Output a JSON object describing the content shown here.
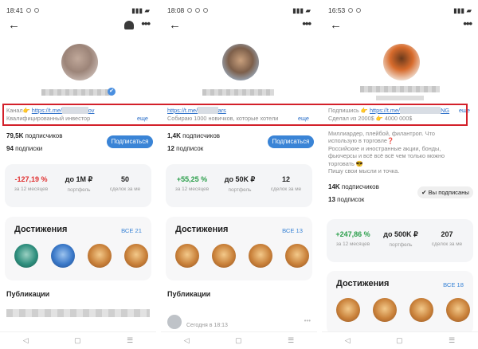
{
  "panels": [
    {
      "status_time": "18:41",
      "bio": {
        "line1_prefix": "Канал👉 ",
        "link": "https://t.me/",
        "link_suffix": "ov",
        "line2": "Квалифицированный инвестор",
        "more": "еще"
      },
      "subscribers": "79,5K",
      "subscribers_label": " подписчиков",
      "following": "94",
      "following_label": " подписки",
      "action_button": "Подписаться",
      "perf": [
        {
          "value": "-127,19 %",
          "label": "за 12 месяцев"
        },
        {
          "value": "до 1М ₽",
          "label": "портфель"
        },
        {
          "value": "50",
          "label": "сделок за ме"
        }
      ],
      "achievements_title": "Достижения",
      "achievements_all": "ВСЕ 21",
      "publications_title": "Публикации"
    },
    {
      "status_time": "18:08",
      "bio": {
        "line1_prefix": "",
        "link": "https://t.me/",
        "link_suffix": "ars",
        "line2": "Собираю 1000 новичков, которые хотели",
        "more": "еще"
      },
      "subscribers": "1,4K",
      "subscribers_label": " подписчиков",
      "following": "12",
      "following_label": " подписок",
      "action_button": "Подписаться",
      "perf": [
        {
          "value": "+55,25 %",
          "label": "за 12 месяцев"
        },
        {
          "value": "до 50K ₽",
          "label": "портфель"
        },
        {
          "value": "12",
          "label": "сделок за ме"
        }
      ],
      "achievements_title": "Достижения",
      "achievements_all": "ВСЕ 13",
      "publications_title": "Публикации",
      "publication_meta": "Сегодня в 18:13"
    },
    {
      "status_time": "16:53",
      "bio": {
        "line1_prefix": "Подпишись 👉 ",
        "link": "https://t.me/",
        "link_suffix": "NG",
        "line2": "Сделал из 2000$ 👉 4000 000$",
        "more": "еще"
      },
      "about": [
        "Миллиардер, плейбой, филантроп. Что",
        "использую в торговле❓",
        "Российские и иностранные акции, бонды,",
        "фьючерсы и всё всё всё чем только можно",
        "торговать 😎",
        "Пишу свои мысли и точка."
      ],
      "subscribers": "14K",
      "subscribers_label": " подписчиков",
      "following": "13",
      "following_label": " подписок",
      "action_button": "✔ Вы подписаны",
      "perf": [
        {
          "value": "+247,86 %",
          "label": "за 12 месяцев"
        },
        {
          "value": "до 500K ₽",
          "label": "портфель"
        },
        {
          "value": "207",
          "label": "сделок за ме"
        }
      ],
      "achievements_title": "Достижения",
      "achievements_all": "ВСЕ 18"
    }
  ],
  "nav": {
    "back": "◁",
    "home": "▢",
    "menu": "☰"
  },
  "icons": {
    "back_arrow": "←",
    "more": "•••",
    "verified": "✔"
  },
  "colors": {
    "accent": "#3a84d6",
    "negative": "#e03030",
    "positive": "#2a9e4a",
    "highlight": "#d3202a"
  }
}
